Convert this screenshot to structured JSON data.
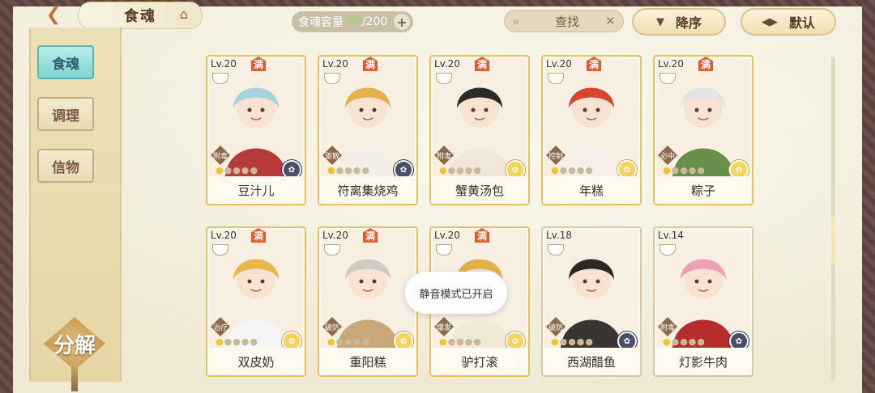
{
  "header": {
    "title": "食魂",
    "capacity_label": "食魂容量",
    "capacity_current": "80",
    "capacity_total": "/200",
    "search_label": "查找",
    "sort_label": "降序",
    "default_label": "默认"
  },
  "sidebar": {
    "tabs": [
      {
        "label": "食魂",
        "active": true
      },
      {
        "label": "调理",
        "active": false
      },
      {
        "label": "信物",
        "active": false
      }
    ],
    "decompose_label": "分解"
  },
  "full_badge": "满",
  "cards": [
    {
      "level": "Lv.20",
      "full": true,
      "role": "附毒",
      "stars": 1,
      "gem": "dark",
      "name": "豆汁儿",
      "colors": {
        "hair": "#a9d3dc",
        "cloth": "#b83a3a"
      }
    },
    {
      "level": "Lv.20",
      "full": true,
      "role": "驱散",
      "stars": 1,
      "gem": "dark",
      "name": "符离集烧鸡",
      "colors": {
        "hair": "#e7b24e",
        "cloth": "#f3efe6"
      }
    },
    {
      "level": "Lv.20",
      "full": true,
      "role": "附毒",
      "stars": 1,
      "gem": "gold",
      "name": "蟹黄汤包",
      "colors": {
        "hair": "#2a2a2a",
        "cloth": "#f0e6dc"
      }
    },
    {
      "level": "Lv.20",
      "full": true,
      "role": "控制",
      "stars": 1,
      "gem": "gold",
      "name": "年糕",
      "colors": {
        "hair": "#d8442c",
        "cloth": "#f7f0e8"
      }
    },
    {
      "level": "Lv.20",
      "full": true,
      "role": "必中",
      "stars": 1,
      "gem": "gold",
      "name": "粽子",
      "colors": {
        "hair": "#e4e4e4",
        "cloth": "#6a8f4a"
      }
    },
    {
      "level": "Lv.20",
      "full": true,
      "role": "治疗",
      "stars": 1,
      "gem": "gold",
      "name": "双皮奶",
      "colors": {
        "hair": "#e8b84a",
        "cloth": "#f5f5f5"
      }
    },
    {
      "level": "Lv.20",
      "full": true,
      "role": "破防",
      "stars": 1,
      "gem": "gold",
      "name": "重阳糕",
      "colors": {
        "hair": "#cfcac2",
        "cloth": "#c8a878"
      }
    },
    {
      "level": "Lv.20",
      "full": true,
      "role": "爆发",
      "stars": 1,
      "gem": "gold",
      "name": "驴打滚",
      "colors": {
        "hair": "#e0b04a",
        "cloth": "#f2e8d8"
      }
    },
    {
      "level": "Lv.18",
      "full": false,
      "role": "破防",
      "stars": 1,
      "gem": "dark",
      "name": "西湖醋鱼",
      "colors": {
        "hair": "#2e2622",
        "cloth": "#3b3532"
      }
    },
    {
      "level": "Lv.14",
      "full": false,
      "role": "附毒",
      "stars": 1,
      "gem": "dark",
      "name": "灯影牛肉",
      "colors": {
        "hair": "#f0a0b4",
        "cloth": "#b82c2c"
      }
    }
  ],
  "toast": "静音模式已开启"
}
